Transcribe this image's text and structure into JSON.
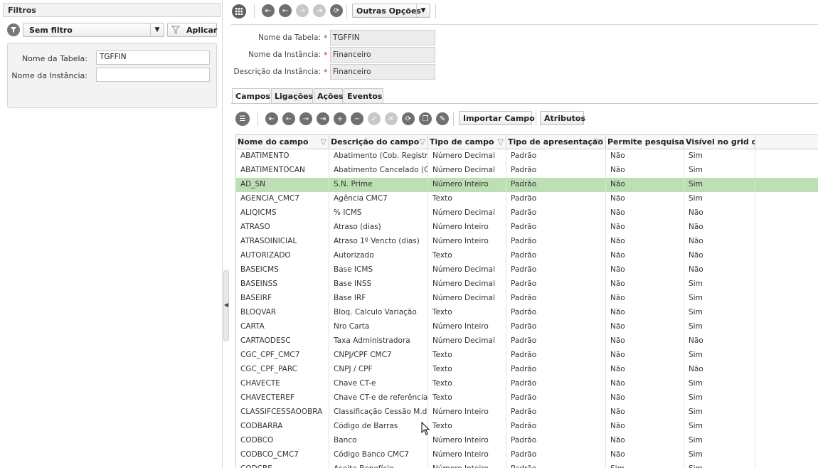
{
  "filters": {
    "title": "Filtros",
    "selected_filter": "Sem filtro",
    "apply_label": "Aplicar",
    "fields": [
      {
        "label": "Nome da Tabela:",
        "value": "TGFFIN"
      },
      {
        "label": "Nome da Instância:",
        "value": ""
      }
    ]
  },
  "toolbar": {
    "more_options_label": "Outras Opções"
  },
  "form": {
    "fields": [
      {
        "label": "Nome da Tabela:",
        "value": "TGFFIN"
      },
      {
        "label": "Nome da Instância:",
        "value": "Financeiro"
      },
      {
        "label": "Descrição da Instância:",
        "value": "Financeiro"
      }
    ],
    "required_mark": "*"
  },
  "tabs": [
    {
      "label": "Campos",
      "active": true
    },
    {
      "label": "Ligações",
      "active": false
    },
    {
      "label": "Ações",
      "active": false
    },
    {
      "label": "Eventos",
      "active": false
    }
  ],
  "grid_toolbar": {
    "import_label": "Importar Campo",
    "attributes_label": "Atributos"
  },
  "grid": {
    "columns": [
      "Nome do campo",
      "Descrição do campo",
      "Tipo de campo",
      "Tipo de apresentação",
      "Permite pesquisa?",
      "Visível no grid de"
    ],
    "rows": [
      [
        "ABATIMENTO",
        "Abatimento (Cob. Registrada)",
        "Número Decimal",
        "Padrão",
        "Não",
        "Sim"
      ],
      [
        "ABATIMENTOCAN",
        "Abatimento Cancelado (Cob.",
        "Número Decimal",
        "Padrão",
        "Não",
        "Sim"
      ],
      [
        "AD_SN",
        "S.N. Prime",
        "Número Inteiro",
        "Padrão",
        "Não",
        "Sim"
      ],
      [
        "AGENCIA_CMC7",
        "Agência CMC7",
        "Texto",
        "Padrão",
        "Não",
        "Sim"
      ],
      [
        "ALIQICMS",
        "% ICMS",
        "Número Decimal",
        "Padrão",
        "Não",
        "Não"
      ],
      [
        "ATRASO",
        "Atraso (dias)",
        "Número Inteiro",
        "Padrão",
        "Não",
        "Não"
      ],
      [
        "ATRASOINICIAL",
        "Atraso 1º Vencto (dias)",
        "Número Inteiro",
        "Padrão",
        "Não",
        "Não"
      ],
      [
        "AUTORIZADO",
        "Autorizado",
        "Texto",
        "Padrão",
        "Não",
        "Não"
      ],
      [
        "BASEICMS",
        "Base ICMS",
        "Número Decimal",
        "Padrão",
        "Não",
        "Não"
      ],
      [
        "BASEINSS",
        "Base INSS",
        "Número Decimal",
        "Padrão",
        "Não",
        "Sim"
      ],
      [
        "BASEIRF",
        "Base IRF",
        "Número Decimal",
        "Padrão",
        "Não",
        "Sim"
      ],
      [
        "BLOQVAR",
        "Bloq. Calculo Variação",
        "Texto",
        "Padrão",
        "Não",
        "Sim"
      ],
      [
        "CARTA",
        "Nro Carta",
        "Número Inteiro",
        "Padrão",
        "Não",
        "Sim"
      ],
      [
        "CARTAODESC",
        "Taxa Administradora",
        "Número Decimal",
        "Padrão",
        "Não",
        "Não"
      ],
      [
        "CGC_CPF_CMC7",
        "CNPJ/CPF CMC7",
        "Texto",
        "Padrão",
        "Não",
        "Sim"
      ],
      [
        "CGC_CPF_PARC",
        "CNPJ / CPF",
        "Texto",
        "Padrão",
        "Não",
        "Não"
      ],
      [
        "CHAVECTE",
        "Chave CT-e",
        "Texto",
        "Padrão",
        "Não",
        "Sim"
      ],
      [
        "CHAVECTEREF",
        "Chave CT-e de referência",
        "Texto",
        "Padrão",
        "Não",
        "Sim"
      ],
      [
        "CLASSIFCESSAOOBRA",
        "Classificação Cessão M.d.O.",
        "Número Inteiro",
        "Padrão",
        "Não",
        "Sim"
      ],
      [
        "CODBARRA",
        "Código de Barras",
        "Texto",
        "Padrão",
        "Não",
        "Sim"
      ],
      [
        "CODBCO",
        "Banco",
        "Número Inteiro",
        "Padrão",
        "Não",
        "Sim"
      ],
      [
        "CODBCO_CMC7",
        "Código Banco CMC7",
        "Número Inteiro",
        "Padrão",
        "Não",
        "Sim"
      ],
      [
        "CODCBE",
        "Aceite Benefício",
        "Número Inteiro",
        "Padrão",
        "Sim",
        "Sim"
      ]
    ],
    "selected_row": 2
  }
}
